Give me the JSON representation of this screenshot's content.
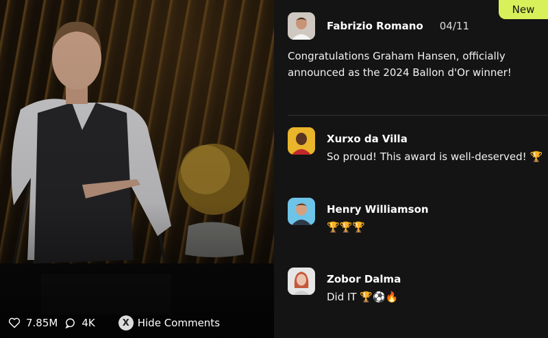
{
  "media": {
    "likes": "7.85M",
    "comments_count": "4K",
    "hide_comments_label": "Hide Comments",
    "hide_button_glyph": "X"
  },
  "badge": {
    "label": "New"
  },
  "post": {
    "author": "Fabrizio Romano",
    "date": "04/11",
    "text": "Congratulations Graham Hansen, officially announced as the 2024 Ballon d'Or winner!"
  },
  "comments": [
    {
      "author": "Xurxo da Villa",
      "text": "So proud! This award is well-deserved! 🏆"
    },
    {
      "author": "Henry Williamson",
      "text": "🏆🏆🏆"
    },
    {
      "author": "Zobor Dalma",
      "text": "Did IT 🏆⚽🔥"
    }
  ],
  "colors": {
    "badge": "#d8f05a",
    "background": "#141414"
  }
}
